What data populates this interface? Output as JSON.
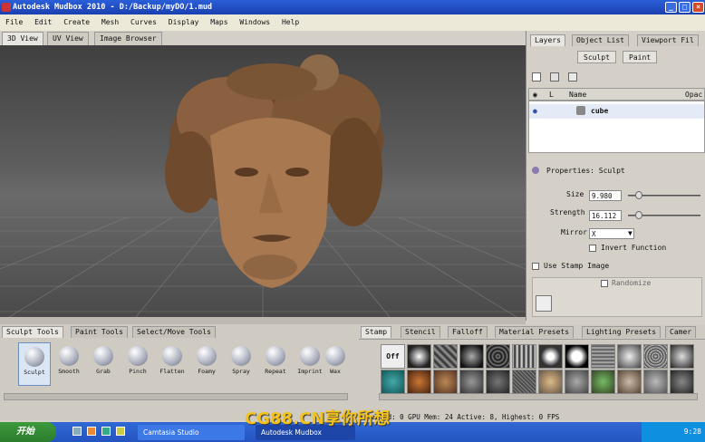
{
  "window": {
    "title": "Autodesk Mudbox 2010 - D:/Backup/myDO/1.mud"
  },
  "menu": [
    "File",
    "Edit",
    "Create",
    "Mesh",
    "Curves",
    "Display",
    "Maps",
    "Windows",
    "Help"
  ],
  "view_tabs": [
    "3D View",
    "UV View",
    "Image Browser"
  ],
  "right_tabs": [
    "Layers",
    "Object List",
    "Viewport Fil"
  ],
  "layer_buttons": {
    "sculpt": "Sculpt",
    "paint": "Paint"
  },
  "layer_header": {
    "name_col": "Name",
    "opacity_col": "Opac",
    "lock_col": "L"
  },
  "layers": [
    {
      "name": "cube"
    }
  ],
  "properties": {
    "title": "Properties: Sculpt",
    "size_label": "Size",
    "size_value": "9.980",
    "strength_label": "Strength",
    "strength_value": "16.112",
    "mirror_label": "Mirror",
    "mirror_value": "X",
    "invert_label": "Invert Function",
    "stamp_label": "Use Stamp Image",
    "randomize_label": "Randomize"
  },
  "bottom_tabs": [
    "Sculpt Tools",
    "Paint Tools",
    "Select/Move Tools"
  ],
  "tools": [
    "Sculpt",
    "Smooth",
    "Grab",
    "Pinch",
    "Flatten",
    "Foamy",
    "Spray",
    "Repeat",
    "Imprint",
    "Wax"
  ],
  "stamp_tabs": [
    "Stamp",
    "Stencil",
    "Falloff",
    "Material Presets",
    "Lighting Presets",
    "Camer"
  ],
  "stamp_off_label": "Off",
  "status": "Selected: 0 GPU Mem: 24   Active: 8, Highest: 0   FPS",
  "taskbar": {
    "start": "开始",
    "tasks": [
      "Camtasia Studio",
      "Autodesk Mudbox"
    ],
    "clock": "9:28"
  },
  "watermark": "CG88.CN享你所想",
  "colors": {
    "titlebar": "#1a3fb0",
    "viewport": "#555555",
    "model": "#9a6b45",
    "taskbar": "#2454c0",
    "watermark": "#f4c21a"
  }
}
